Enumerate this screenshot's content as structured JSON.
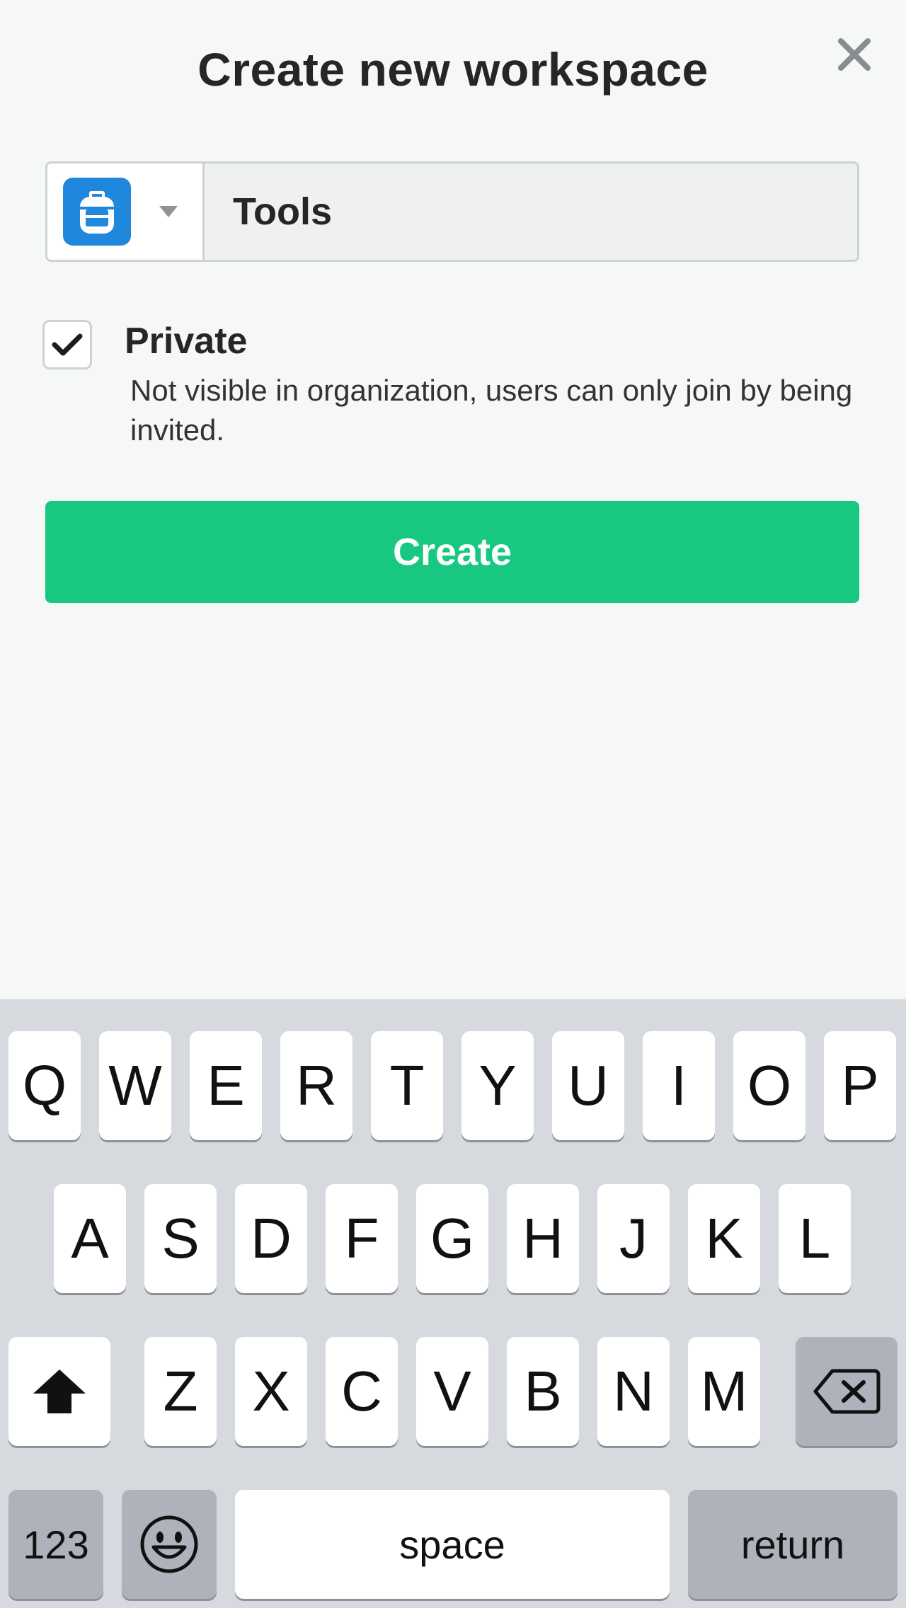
{
  "header": {
    "title": "Create new workspace"
  },
  "workspace": {
    "icon": "backpack-icon",
    "icon_color": "#1f87dc",
    "name_value": "Tools"
  },
  "private_option": {
    "checked": true,
    "label": "Private",
    "description": "Not visible in organization, users can only join by being invited."
  },
  "create_button": {
    "label": "Create",
    "color": "#18c880"
  },
  "keyboard": {
    "row1": [
      "Q",
      "W",
      "E",
      "R",
      "T",
      "Y",
      "U",
      "I",
      "O",
      "P"
    ],
    "row2": [
      "A",
      "S",
      "D",
      "F",
      "G",
      "H",
      "J",
      "K",
      "L"
    ],
    "row3": [
      "Z",
      "X",
      "C",
      "V",
      "B",
      "N",
      "M"
    ],
    "numbers_label": "123",
    "space_label": "space",
    "return_label": "return"
  }
}
